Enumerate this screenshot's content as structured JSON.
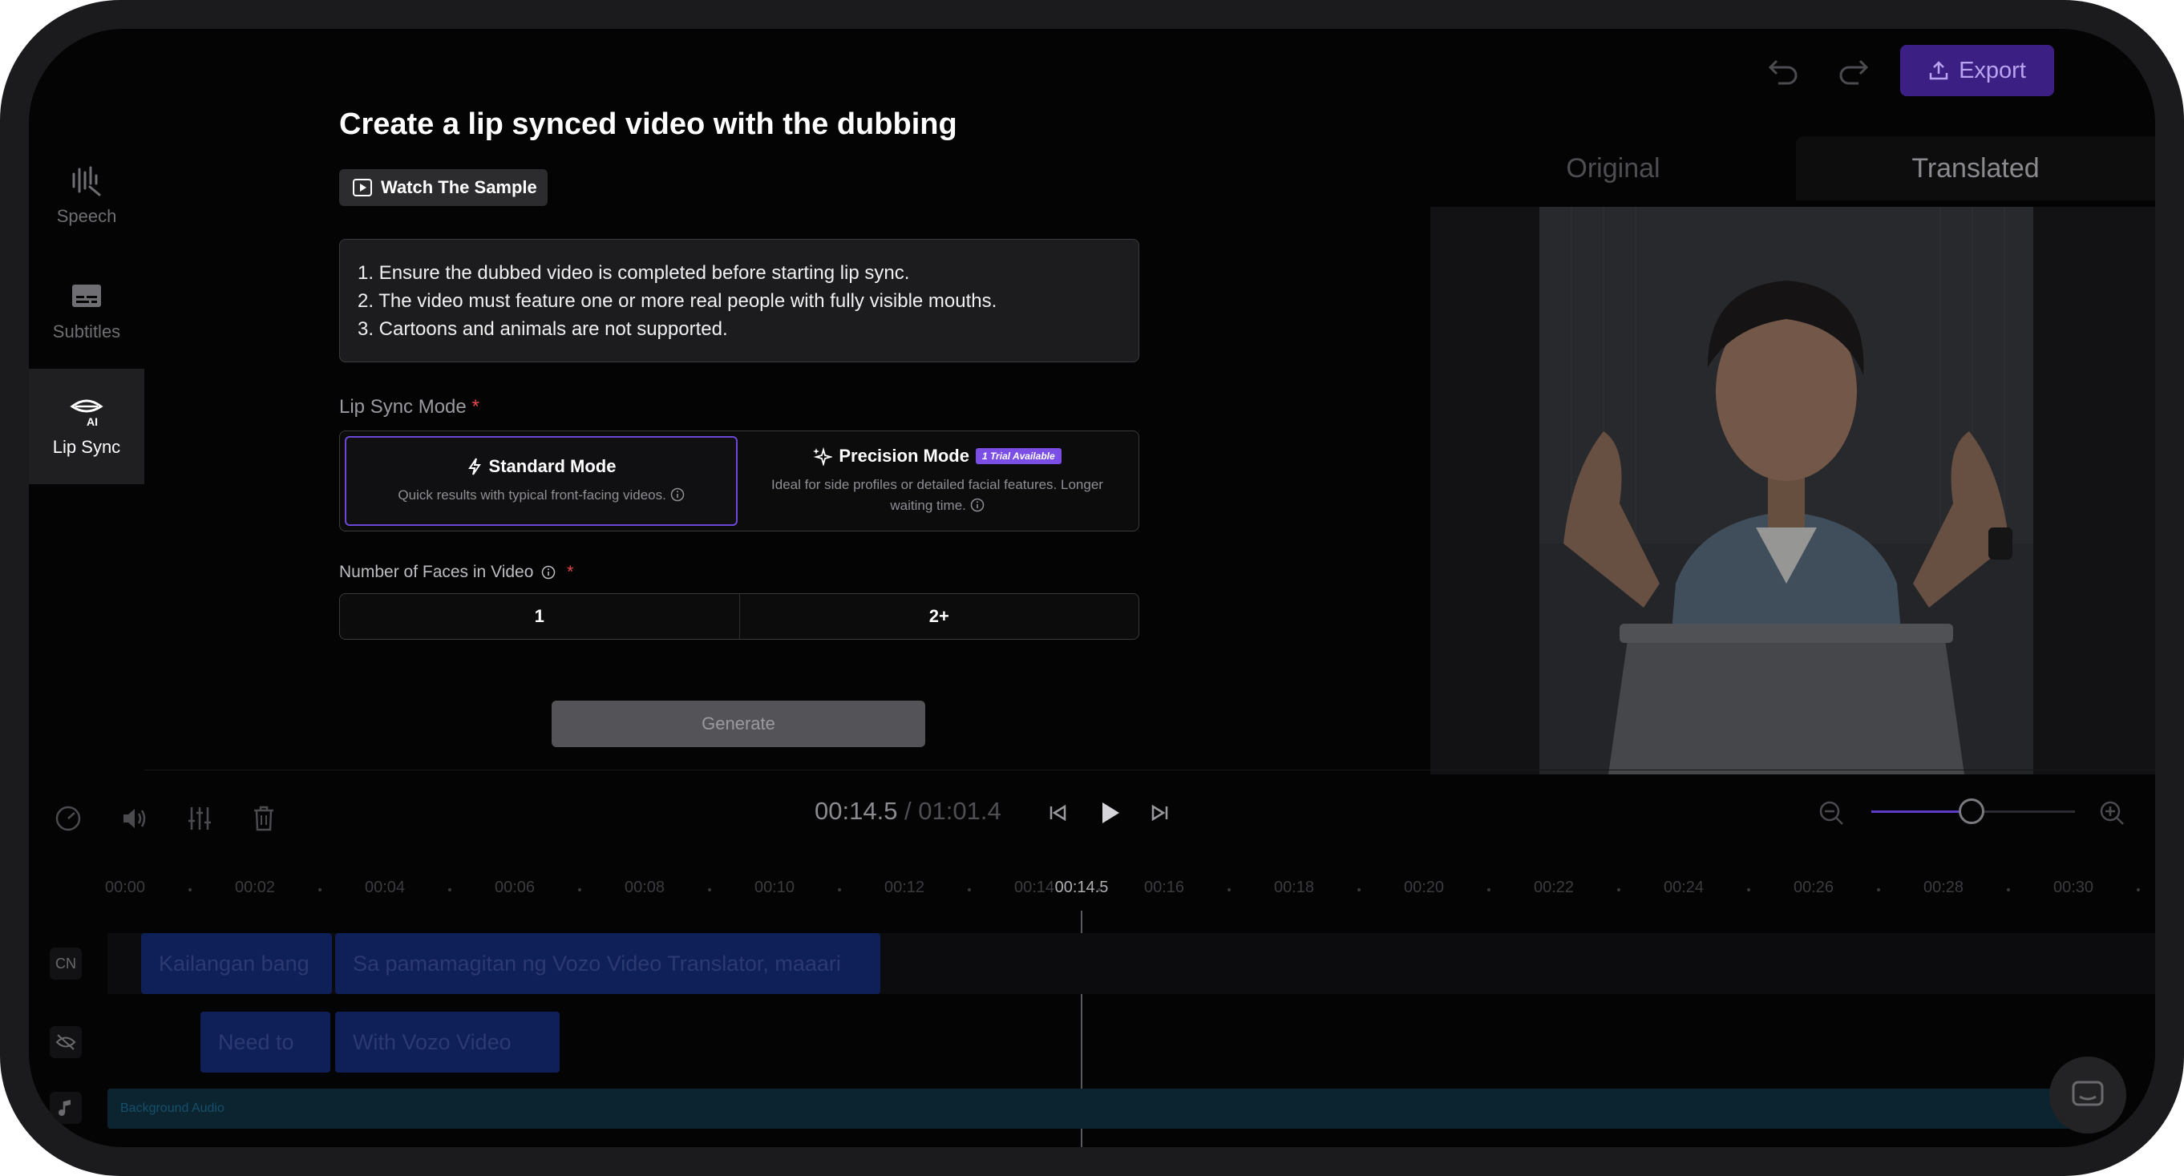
{
  "sidebar": {
    "items": [
      {
        "label": "Speech",
        "icon": "waveform-icon"
      },
      {
        "label": "Subtitles",
        "icon": "subtitles-icon"
      },
      {
        "label": "Lip Sync",
        "icon": "lip-sync-ai-icon",
        "active": true
      }
    ]
  },
  "toolbar": {
    "export_label": "Export"
  },
  "panel": {
    "title": "Create a lip synced video with the dubbing",
    "watch_sample": "Watch The Sample",
    "rules": [
      "1. Ensure the dubbed video is completed before starting lip sync.",
      "2. The video must feature one or more real people with fully visible mouths.",
      "3. Cartoons and animals are not supported."
    ],
    "mode_label": "Lip Sync Mode",
    "required_mark": "*",
    "standard_mode": {
      "title": "Standard Mode",
      "desc": "Quick results with typical front-facing videos."
    },
    "precision_mode": {
      "title": "Precision Mode",
      "badge": "1 Trial Available",
      "desc": "Ideal for side profiles or detailed facial features. Longer waiting time."
    },
    "faces_label": "Number of Faces in Video",
    "faces_options": [
      "1",
      "2+"
    ],
    "generate_label": "Generate"
  },
  "preview": {
    "tab_original": "Original",
    "tab_translated": "Translated"
  },
  "player": {
    "current_time": "00:14.5",
    "separator": " / ",
    "total_time": "01:01.4"
  },
  "timeline": {
    "ticks": [
      "00:00",
      "00:02",
      "00:04",
      "00:06",
      "00:08",
      "00:10",
      "00:12",
      "00:14",
      "00:16",
      "00:18",
      "00:20",
      "00:22",
      "00:24",
      "00:26",
      "00:28",
      "00:30"
    ],
    "playhead_label": "00:14.5",
    "track1_label": "CN",
    "track1_clips": [
      "Kailangan bang",
      "Sa pamamagitan ng Vozo Video Translator, maaari"
    ],
    "track2_clips": [
      "Need to",
      "With Vozo Video"
    ],
    "audio_label": "Background Audio"
  },
  "colors": {
    "accent": "#3b1f82",
    "selected_border": "#6b48d6",
    "badge": "#7b4fe6",
    "clip": "#0f1f57",
    "audio": "#0c2330"
  }
}
